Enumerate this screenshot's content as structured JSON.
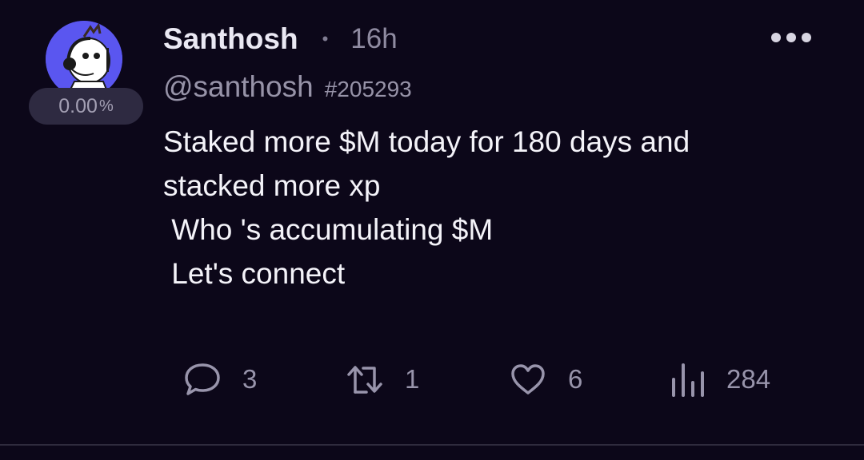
{
  "post": {
    "author": {
      "display_name": "Santhosh",
      "handle": "@santhosh",
      "fid": "#205293",
      "avatar_icon": "cartoon-headset-avatar",
      "score_value": "0.00",
      "score_unit": "%"
    },
    "separator": "•",
    "timestamp": "16h",
    "more_icon": "more-horizontal-icon",
    "content_lines": [
      "Staked more $M today for 180 days and",
      "stacked more xp",
      " Who 's accumulating $M",
      " Let's connect"
    ],
    "actions": {
      "comments": {
        "icon": "comment-icon",
        "count": "3"
      },
      "recasts": {
        "icon": "recast-icon",
        "count": "1"
      },
      "likes": {
        "icon": "heart-icon",
        "count": "6"
      },
      "views": {
        "icon": "views-chart-icon",
        "count": "284"
      }
    }
  },
  "colors": {
    "background": "#0c0719",
    "avatar_bg": "#5a56f0",
    "badge_bg": "#2e2a41",
    "muted_text": "#9793a8"
  }
}
